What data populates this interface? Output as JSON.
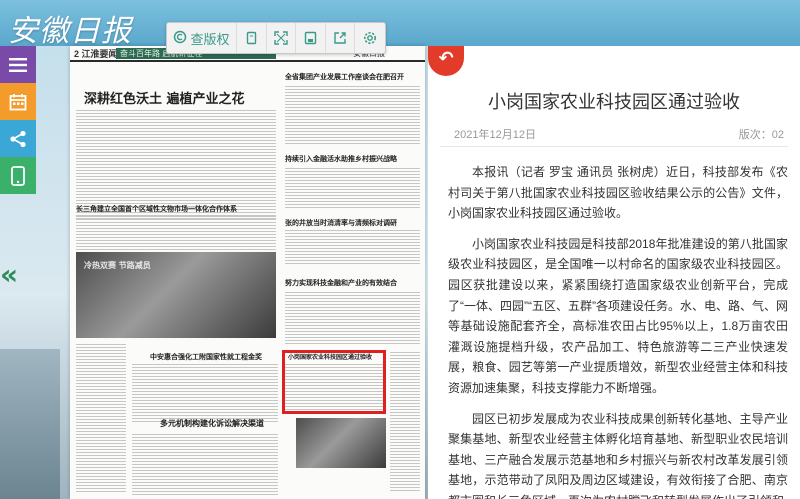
{
  "app": {
    "logo": "安徽日报"
  },
  "toolbar": {
    "view_label": "查版权"
  },
  "icons": {
    "menu": "menu-icon",
    "calendar": "calendar-icon",
    "share": "share-icon",
    "mobile": "mobile-icon",
    "collapse": "chevron-left-double-icon",
    "copyright": "copyright-icon",
    "copy": "copy-icon",
    "fullscreen": "fullscreen-icon",
    "save": "save-icon",
    "export": "export-icon",
    "settings": "gear-icon",
    "back": "back-arrow-icon"
  },
  "colors": {
    "menu": "#7a4aa8",
    "calendar": "#f39b2b",
    "share": "#3aa7d6",
    "mobile": "#3bb06a",
    "accent": "#e23b2a",
    "highlight_box": "#e02020"
  },
  "newspaper": {
    "page_number": "2",
    "section": "江淮要闻",
    "band": "奋斗百年路 启航新征程",
    "right_head": "安徽日报",
    "headlines": {
      "h1": "深耕红色沃土 遍植产业之花",
      "h2": "全省集团产业发展工作座谈会在肥召开",
      "h3": "持续引入金融活水助推乡村振兴战略",
      "h4": "长三角建立全国首个区域性文物市场一体化合作体系",
      "h5": "张的井放当时消清率与清频标对调研",
      "h6": "努力实现科技金融和产业的有效结合",
      "h7": "冷热双赛 节路减员",
      "h8": "中安惠合强化工附国家性就工程金奖",
      "h9": "小岗国家农业科技园区通过验收",
      "h10": "多元机制构建化诉讼解决渠道"
    }
  },
  "article": {
    "title": "小岗国家农业科技园区通过验收",
    "date": "2021年12月12日",
    "edition": "版次：02",
    "paragraphs": [
      "本报讯（记者 罗宝 通讯员 张树虎）近日，科技部发布《农村司关于第八批国家农业科技园区验收结果公示的公告》文件，小岗国家农业科技园区通过验收。",
      "小岗国家农业科技园是科技部2018年批准建设的第八批国家级农业科技园区，是全国唯一以村命名的国家级农业科技园区。园区获批建设以来，紧紧围绕打造国家级农业创新平台，完成了“一体、四园”“五区、五群”各项建设任务。水、电、路、气、网等基础设施配套齐全，高标准农田占比95%以上，1.8万亩农田灌溉设施提档升级，农产品加工、特色旅游等二三产业快速发展，粮食、园艺等第一产业提质增效，新型农业经营主体和科技资源加速集聚，科技支撑能力不断增强。",
      "园区已初步发展成为农业科技成果创新转化基地、主导产业聚集基地、新型农业经营主体孵化培育基地、新型职业农民培训基地、三产融合发展示范基地和乡村振兴与新农村改革发展引领基地，示范带动了凤阳及周边区域建设，有效衔接了合肥、南京都市圈和长三角区域，再次为农村蹚飞和转型发展作出了引领和"
    ]
  }
}
